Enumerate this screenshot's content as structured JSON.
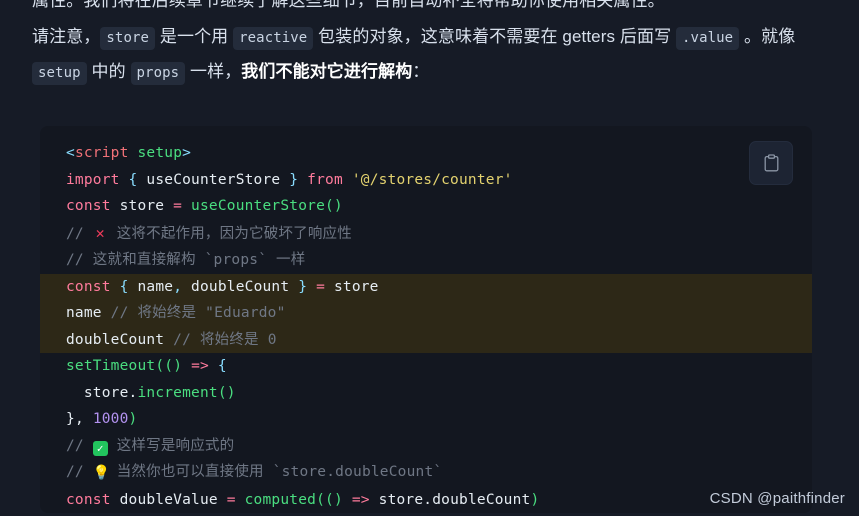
{
  "page": {
    "background": "#161b26",
    "code_background": "#131720",
    "highlight_background": "#2d2817",
    "inline_code_background": "#242c3b"
  },
  "prose": {
    "clipped_line": "属性。我们将在后续章节继续了解这些细节，目前自动补全将帮助你使用相关属性。",
    "paragraph": {
      "p1": "请注意，",
      "code1": "store",
      "p2": " 是一个用 ",
      "code2": "reactive",
      "p3": " 包装的对象，这意味着不需要在 getters 后面写 ",
      "code3": ".value",
      "p4": " 。就像 ",
      "code4": "setup",
      "p5": " 中的 ",
      "code5": "props",
      "p6": " 一样，",
      "bold": "我们不能对它进行解构",
      "p7": "："
    }
  },
  "code_block": {
    "copy_button_label": "copy",
    "lines": [
      {
        "id": "l1",
        "highlight": false,
        "tokens": [
          {
            "t": "<",
            "c": "t-punct"
          },
          {
            "t": "script",
            "c": "t-tag"
          },
          {
            "t": " ",
            "c": "t-white"
          },
          {
            "t": "setup",
            "c": "t-fn"
          },
          {
            "t": ">",
            "c": "t-punct"
          }
        ]
      },
      {
        "id": "l2",
        "highlight": false,
        "tokens": [
          {
            "t": "import",
            "c": "t-kw"
          },
          {
            "t": " ",
            "c": "t-white"
          },
          {
            "t": "{",
            "c": "t-punct"
          },
          {
            "t": " useCounterStore ",
            "c": "t-white"
          },
          {
            "t": "}",
            "c": "t-punct"
          },
          {
            "t": " ",
            "c": "t-white"
          },
          {
            "t": "from",
            "c": "t-kw"
          },
          {
            "t": " ",
            "c": "t-white"
          },
          {
            "t": "'@/stores/counter'",
            "c": "t-str"
          }
        ]
      },
      {
        "id": "l3",
        "highlight": false,
        "tokens": [
          {
            "t": "const",
            "c": "t-kw"
          },
          {
            "t": " store ",
            "c": "t-white"
          },
          {
            "t": "=",
            "c": "t-op"
          },
          {
            "t": " ",
            "c": "t-white"
          },
          {
            "t": "useCounterStore",
            "c": "t-fn"
          },
          {
            "t": "()",
            "c": "t-paren"
          }
        ]
      },
      {
        "id": "l4",
        "highlight": false,
        "emoji": "cross",
        "tokens": [
          {
            "t": "// ",
            "c": "t-comment"
          },
          {
            "t": "@EMOJI@",
            "c": "emoji-x"
          },
          {
            "t": " 这将不起作用，因为它破坏了响应性",
            "c": "t-comment"
          }
        ]
      },
      {
        "id": "l5",
        "highlight": false,
        "tokens": [
          {
            "t": "// 这就和直接解构 `props` 一样",
            "c": "t-comment"
          }
        ]
      },
      {
        "id": "l6",
        "highlight": true,
        "tokens": [
          {
            "t": "const",
            "c": "t-kw"
          },
          {
            "t": " ",
            "c": "t-white"
          },
          {
            "t": "{",
            "c": "t-punct"
          },
          {
            "t": " name",
            "c": "t-white"
          },
          {
            "t": ",",
            "c": "t-punct"
          },
          {
            "t": " doubleCount ",
            "c": "t-white"
          },
          {
            "t": "}",
            "c": "t-punct"
          },
          {
            "t": " ",
            "c": "t-white"
          },
          {
            "t": "=",
            "c": "t-op"
          },
          {
            "t": " store",
            "c": "t-white"
          }
        ]
      },
      {
        "id": "l7",
        "highlight": true,
        "tokens": [
          {
            "t": "name ",
            "c": "t-white"
          },
          {
            "t": "// 将始终是 \"Eduardo\"",
            "c": "t-comment"
          }
        ]
      },
      {
        "id": "l8",
        "highlight": true,
        "tokens": [
          {
            "t": "doubleCount ",
            "c": "t-white"
          },
          {
            "t": "// 将始终是 0",
            "c": "t-comment"
          }
        ]
      },
      {
        "id": "l9",
        "highlight": false,
        "tokens": [
          {
            "t": "setTimeout",
            "c": "t-fn"
          },
          {
            "t": "((",
            "c": "t-paren"
          },
          {
            "t": ")",
            "c": "t-paren"
          },
          {
            "t": " ",
            "c": "t-white"
          },
          {
            "t": "=>",
            "c": "t-arrow"
          },
          {
            "t": " ",
            "c": "t-white"
          },
          {
            "t": "{",
            "c": "t-punct"
          }
        ]
      },
      {
        "id": "l10",
        "highlight": false,
        "tokens": [
          {
            "t": "  store",
            "c": "t-white"
          },
          {
            "t": ".",
            "c": "t-white"
          },
          {
            "t": "increment",
            "c": "t-fn"
          },
          {
            "t": "()",
            "c": "t-paren"
          }
        ]
      },
      {
        "id": "l11",
        "highlight": false,
        "tokens": [
          {
            "t": "}",
            "c": "t-white"
          },
          {
            "t": ", ",
            "c": "t-white"
          },
          {
            "t": "1000",
            "c": "t-num"
          },
          {
            "t": ")",
            "c": "t-paren"
          }
        ]
      },
      {
        "id": "l12",
        "highlight": false,
        "emoji": "check",
        "tokens": [
          {
            "t": "// ",
            "c": "t-comment"
          },
          {
            "t": "@EMOJI@",
            "c": "emoji-check"
          },
          {
            "t": " 这样写是响应式的",
            "c": "t-comment"
          }
        ]
      },
      {
        "id": "l13",
        "highlight": false,
        "emoji": "bulb",
        "tokens": [
          {
            "t": "// ",
            "c": "t-comment"
          },
          {
            "t": "@EMOJI@",
            "c": "emoji-bulb"
          },
          {
            "t": " 当然你也可以直接使用 `store.doubleCount`",
            "c": "t-comment"
          }
        ]
      },
      {
        "id": "l14",
        "highlight": false,
        "tokens": [
          {
            "t": "const",
            "c": "t-kw"
          },
          {
            "t": " doubleValue ",
            "c": "t-white"
          },
          {
            "t": "=",
            "c": "t-op"
          },
          {
            "t": " ",
            "c": "t-white"
          },
          {
            "t": "computed",
            "c": "t-fn"
          },
          {
            "t": "((",
            "c": "t-paren"
          },
          {
            "t": ")",
            "c": "t-paren"
          },
          {
            "t": " ",
            "c": "t-white"
          },
          {
            "t": "=>",
            "c": "t-arrow"
          },
          {
            "t": " store",
            "c": "t-white"
          },
          {
            "t": ".",
            "c": "t-white"
          },
          {
            "t": "doubleCount",
            "c": "t-white"
          },
          {
            "t": ")",
            "c": "t-paren"
          }
        ]
      }
    ]
  },
  "watermark": {
    "text": "CSDN @paithfinder"
  },
  "emoji_glyphs": {
    "cross": "✕",
    "check": "✓",
    "bulb": "💡"
  }
}
